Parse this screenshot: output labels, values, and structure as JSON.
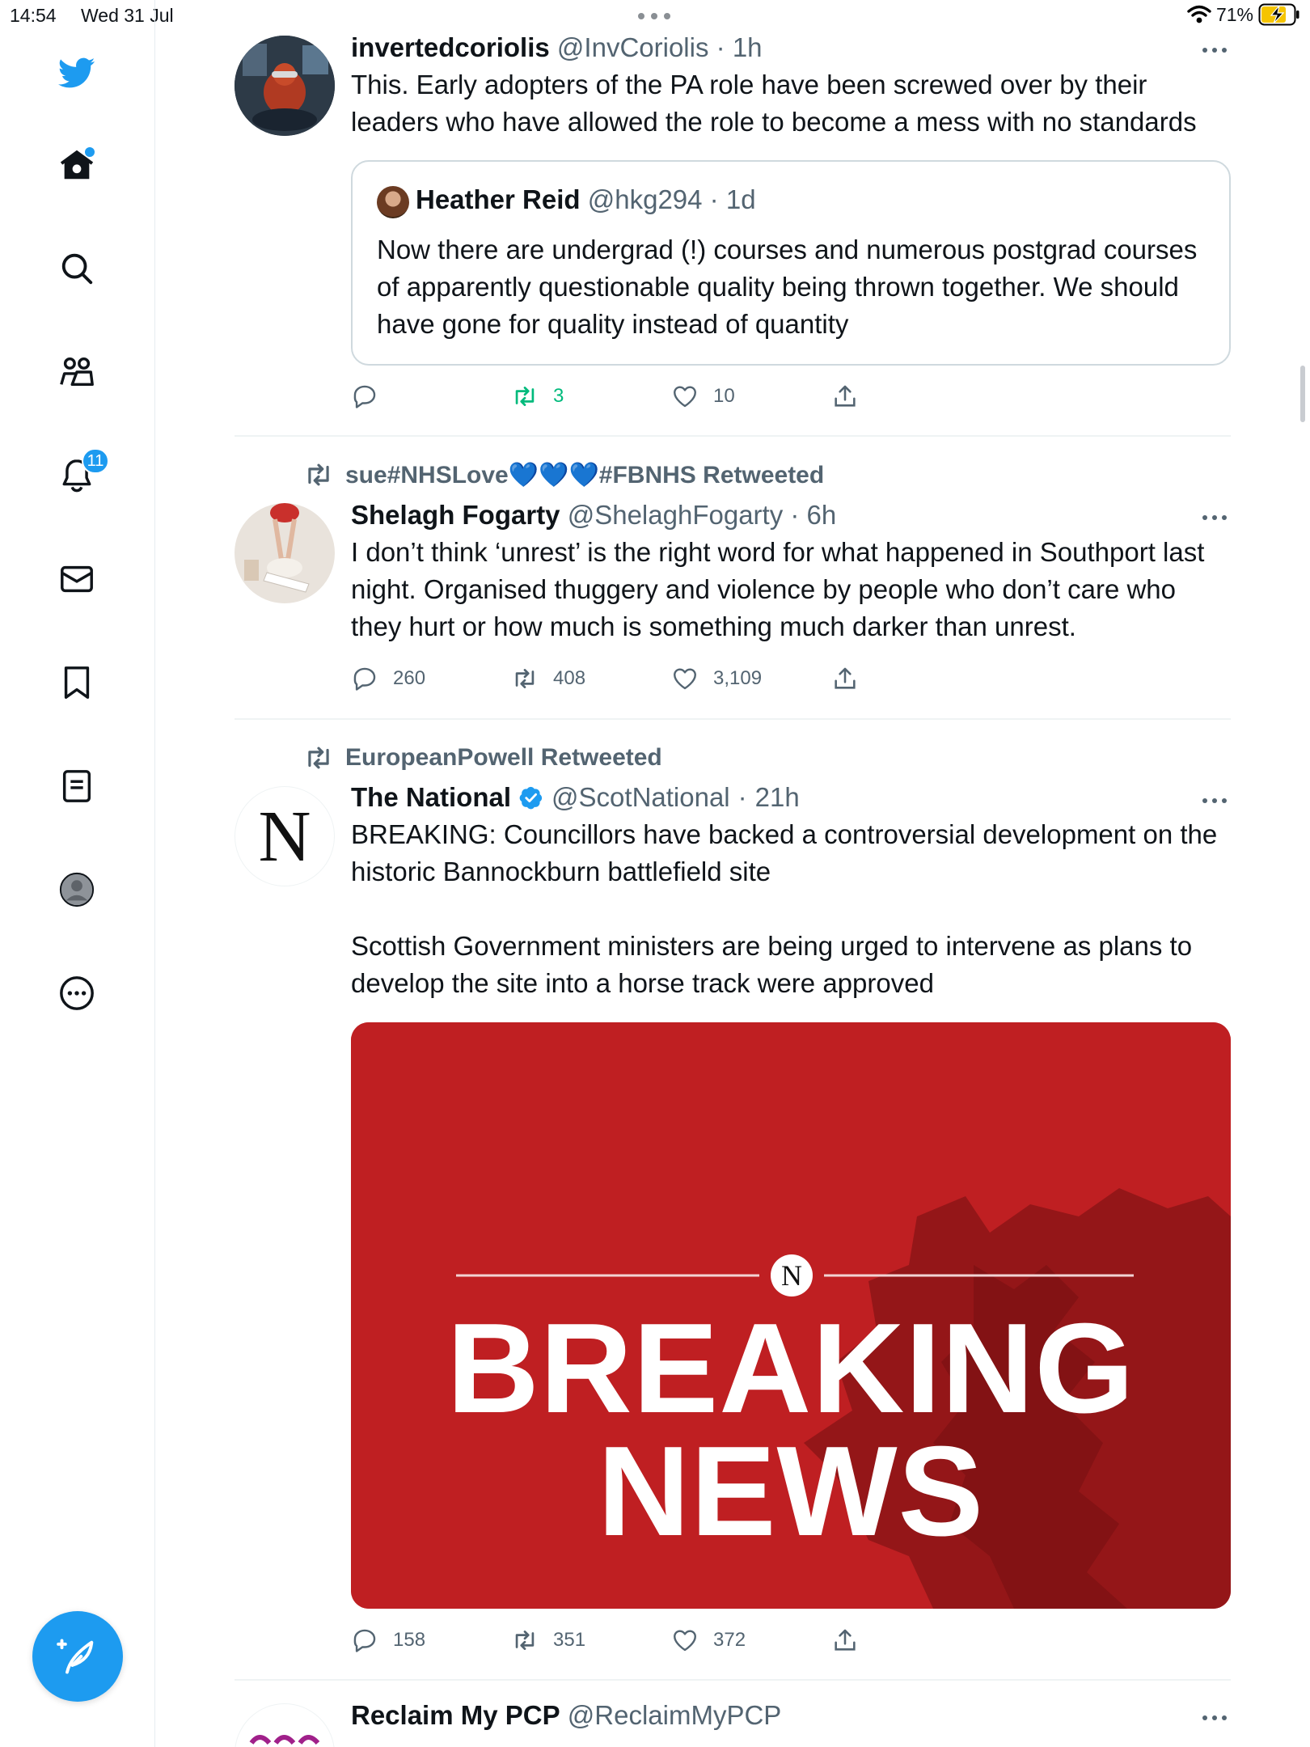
{
  "status_bar": {
    "time": "14:54",
    "date": "Wed 31 Jul",
    "battery": "71%"
  },
  "sidebar": {
    "notifications_badge": "11"
  },
  "tweets": [
    {
      "name": "invertedcoriolis",
      "handle": "@InvCoriolis",
      "time": "1h",
      "text": "This. Early adopters of the PA role have been screwed over by their leaders who have allowed the role to become a mess with no standards",
      "quote": {
        "name": "Heather Reid",
        "handle": "@hkg294",
        "time": "1d",
        "text": "Now there are undergrad (!) courses and numerous postgrad courses of apparently questionable quality being thrown together. We should have gone for quality instead of quantity"
      },
      "replies": "",
      "retweets": "3",
      "likes": "10"
    },
    {
      "retweeted_by": "sue#NHSLove💙💙💙#FBNHS Retweeted",
      "name": "Shelagh Fogarty",
      "handle": "@ShelaghFogarty",
      "time": "6h",
      "text": "I don’t think ‘unrest’ is the right word for what happened in Southport last night. Organised thuggery and violence by people who don’t care who they hurt or how much is something much darker than unrest.",
      "replies": "260",
      "retweets": "408",
      "likes": "3,109"
    },
    {
      "retweeted_by": "EuropeanPowell Retweeted",
      "name": "The National",
      "handle": "@ScotNational",
      "time": "21h",
      "avatar_letter": "N",
      "text_1": "BREAKING: Councillors have backed a controversial development on the historic Bannockburn battlefield site",
      "text_2": "Scottish Government ministers are being urged to intervene as plans to develop the site into a horse track were approved",
      "media": {
        "badge": "N",
        "line1": "BREAKING",
        "line2": "NEWS"
      },
      "replies": "158",
      "retweets": "351",
      "likes": "372"
    },
    {
      "name": "Reclaim My PCP",
      "handle": "@ReclaimMyPCP"
    }
  ],
  "colors": {
    "accent": "#1d9bf0",
    "retweet_green": "#00ba7c",
    "breaking_red": "#bf1f22"
  }
}
